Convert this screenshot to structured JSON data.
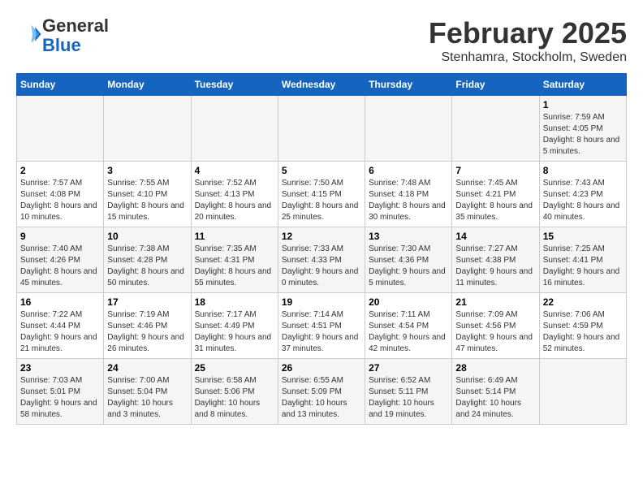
{
  "logo": {
    "general": "General",
    "blue": "Blue"
  },
  "header": {
    "month": "February 2025",
    "location": "Stenhamra, Stockholm, Sweden"
  },
  "weekdays": [
    "Sunday",
    "Monday",
    "Tuesday",
    "Wednesday",
    "Thursday",
    "Friday",
    "Saturday"
  ],
  "weeks": [
    [
      {
        "day": "",
        "info": ""
      },
      {
        "day": "",
        "info": ""
      },
      {
        "day": "",
        "info": ""
      },
      {
        "day": "",
        "info": ""
      },
      {
        "day": "",
        "info": ""
      },
      {
        "day": "",
        "info": ""
      },
      {
        "day": "1",
        "info": "Sunrise: 7:59 AM\nSunset: 4:05 PM\nDaylight: 8 hours and 5 minutes."
      }
    ],
    [
      {
        "day": "2",
        "info": "Sunrise: 7:57 AM\nSunset: 4:08 PM\nDaylight: 8 hours and 10 minutes."
      },
      {
        "day": "3",
        "info": "Sunrise: 7:55 AM\nSunset: 4:10 PM\nDaylight: 8 hours and 15 minutes."
      },
      {
        "day": "4",
        "info": "Sunrise: 7:52 AM\nSunset: 4:13 PM\nDaylight: 8 hours and 20 minutes."
      },
      {
        "day": "5",
        "info": "Sunrise: 7:50 AM\nSunset: 4:15 PM\nDaylight: 8 hours and 25 minutes."
      },
      {
        "day": "6",
        "info": "Sunrise: 7:48 AM\nSunset: 4:18 PM\nDaylight: 8 hours and 30 minutes."
      },
      {
        "day": "7",
        "info": "Sunrise: 7:45 AM\nSunset: 4:21 PM\nDaylight: 8 hours and 35 minutes."
      },
      {
        "day": "8",
        "info": "Sunrise: 7:43 AM\nSunset: 4:23 PM\nDaylight: 8 hours and 40 minutes."
      }
    ],
    [
      {
        "day": "9",
        "info": "Sunrise: 7:40 AM\nSunset: 4:26 PM\nDaylight: 8 hours and 45 minutes."
      },
      {
        "day": "10",
        "info": "Sunrise: 7:38 AM\nSunset: 4:28 PM\nDaylight: 8 hours and 50 minutes."
      },
      {
        "day": "11",
        "info": "Sunrise: 7:35 AM\nSunset: 4:31 PM\nDaylight: 8 hours and 55 minutes."
      },
      {
        "day": "12",
        "info": "Sunrise: 7:33 AM\nSunset: 4:33 PM\nDaylight: 9 hours and 0 minutes."
      },
      {
        "day": "13",
        "info": "Sunrise: 7:30 AM\nSunset: 4:36 PM\nDaylight: 9 hours and 5 minutes."
      },
      {
        "day": "14",
        "info": "Sunrise: 7:27 AM\nSunset: 4:38 PM\nDaylight: 9 hours and 11 minutes."
      },
      {
        "day": "15",
        "info": "Sunrise: 7:25 AM\nSunset: 4:41 PM\nDaylight: 9 hours and 16 minutes."
      }
    ],
    [
      {
        "day": "16",
        "info": "Sunrise: 7:22 AM\nSunset: 4:44 PM\nDaylight: 9 hours and 21 minutes."
      },
      {
        "day": "17",
        "info": "Sunrise: 7:19 AM\nSunset: 4:46 PM\nDaylight: 9 hours and 26 minutes."
      },
      {
        "day": "18",
        "info": "Sunrise: 7:17 AM\nSunset: 4:49 PM\nDaylight: 9 hours and 31 minutes."
      },
      {
        "day": "19",
        "info": "Sunrise: 7:14 AM\nSunset: 4:51 PM\nDaylight: 9 hours and 37 minutes."
      },
      {
        "day": "20",
        "info": "Sunrise: 7:11 AM\nSunset: 4:54 PM\nDaylight: 9 hours and 42 minutes."
      },
      {
        "day": "21",
        "info": "Sunrise: 7:09 AM\nSunset: 4:56 PM\nDaylight: 9 hours and 47 minutes."
      },
      {
        "day": "22",
        "info": "Sunrise: 7:06 AM\nSunset: 4:59 PM\nDaylight: 9 hours and 52 minutes."
      }
    ],
    [
      {
        "day": "23",
        "info": "Sunrise: 7:03 AM\nSunset: 5:01 PM\nDaylight: 9 hours and 58 minutes."
      },
      {
        "day": "24",
        "info": "Sunrise: 7:00 AM\nSunset: 5:04 PM\nDaylight: 10 hours and 3 minutes."
      },
      {
        "day": "25",
        "info": "Sunrise: 6:58 AM\nSunset: 5:06 PM\nDaylight: 10 hours and 8 minutes."
      },
      {
        "day": "26",
        "info": "Sunrise: 6:55 AM\nSunset: 5:09 PM\nDaylight: 10 hours and 13 minutes."
      },
      {
        "day": "27",
        "info": "Sunrise: 6:52 AM\nSunset: 5:11 PM\nDaylight: 10 hours and 19 minutes."
      },
      {
        "day": "28",
        "info": "Sunrise: 6:49 AM\nSunset: 5:14 PM\nDaylight: 10 hours and 24 minutes."
      },
      {
        "day": "",
        "info": ""
      }
    ]
  ]
}
